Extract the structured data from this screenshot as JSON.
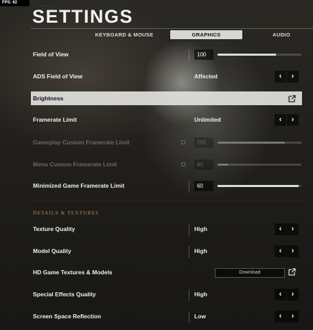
{
  "fps": "FPS: 62",
  "header": {
    "subtitle": "··· ·······",
    "title": "SETTINGS"
  },
  "tabs": [
    {
      "label": "KEYBOARD & MOUSE",
      "active": false
    },
    {
      "label": "GRAPHICS",
      "active": true
    },
    {
      "label": "AUDIO",
      "active": false
    }
  ],
  "rows": {
    "fov": {
      "label": "Field of View",
      "value": "100",
      "fill": 0.7
    },
    "ads_fov": {
      "label": "ADS Field of View",
      "value": "Affected"
    },
    "brightness": {
      "label": "Brightness"
    },
    "framerate_limit": {
      "label": "Framerate Limit",
      "value": "Unlimited"
    },
    "gameplay_custom": {
      "label": "Gameplay Custom Framerate Limit",
      "value": "250",
      "fill": 0.8
    },
    "menu_custom": {
      "label": "Menu Custom Framerate Limit",
      "value": "60",
      "fill": 0.12
    },
    "minimized": {
      "label": "Minimized Game Framerate Limit",
      "value": "60",
      "fill": 0.97
    }
  },
  "section_details": "DETAILS & TEXTURES",
  "details": {
    "texture_quality": {
      "label": "Texture Quality",
      "value": "High"
    },
    "model_quality": {
      "label": "Model Quality",
      "value": "High"
    },
    "hd_textures": {
      "label": "HD Game Textures & Models",
      "button": "Download"
    },
    "special_effects": {
      "label": "Special Effects Quality",
      "value": "High"
    },
    "ssr": {
      "label": "Screen Space Reflection",
      "value": "Low"
    }
  },
  "icons": {
    "arrow_left": "chevron-left-icon",
    "arrow_right": "chevron-right-icon",
    "external": "external-link-icon",
    "lock": "lock-icon"
  },
  "colors": {
    "accent_section": "#b48a5a",
    "tab_active_bg": "#d6d6d4",
    "highlight_row": "#e1e1de"
  }
}
